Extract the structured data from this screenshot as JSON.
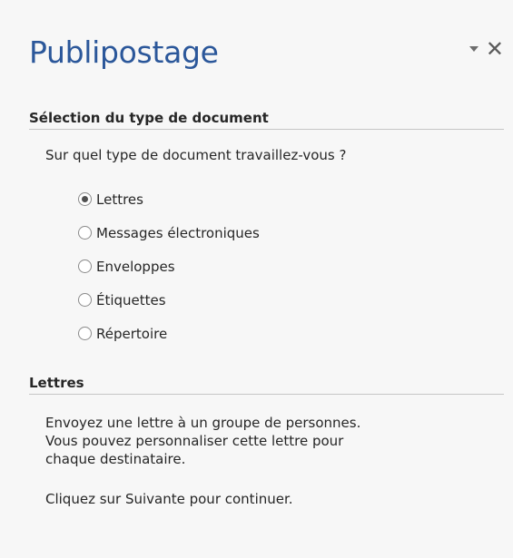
{
  "pane": {
    "title": "Publipostage",
    "controls": {
      "dropdown_icon": "triangle-down-icon",
      "close_icon": "close-icon",
      "close_glyph": "✕"
    }
  },
  "type_section": {
    "header": "Sélection du type de document",
    "question": "Sur quel type de document travaillez-vous ?",
    "options": [
      {
        "label": "Lettres",
        "selected": true
      },
      {
        "label": "Messages électroniques",
        "selected": false
      },
      {
        "label": "Enveloppes",
        "selected": false
      },
      {
        "label": "Étiquettes",
        "selected": false
      },
      {
        "label": "Répertoire",
        "selected": false
      }
    ]
  },
  "info_section": {
    "header": "Lettres",
    "description_lines": [
      "Envoyez une lettre à un groupe de personnes.",
      "Vous pouvez personnaliser cette lettre pour",
      "chaque destinataire."
    ],
    "instruction": "Cliquez sur Suivante pour continuer."
  },
  "colors": {
    "title": "#2b579a",
    "background": "#f7f7f7"
  }
}
